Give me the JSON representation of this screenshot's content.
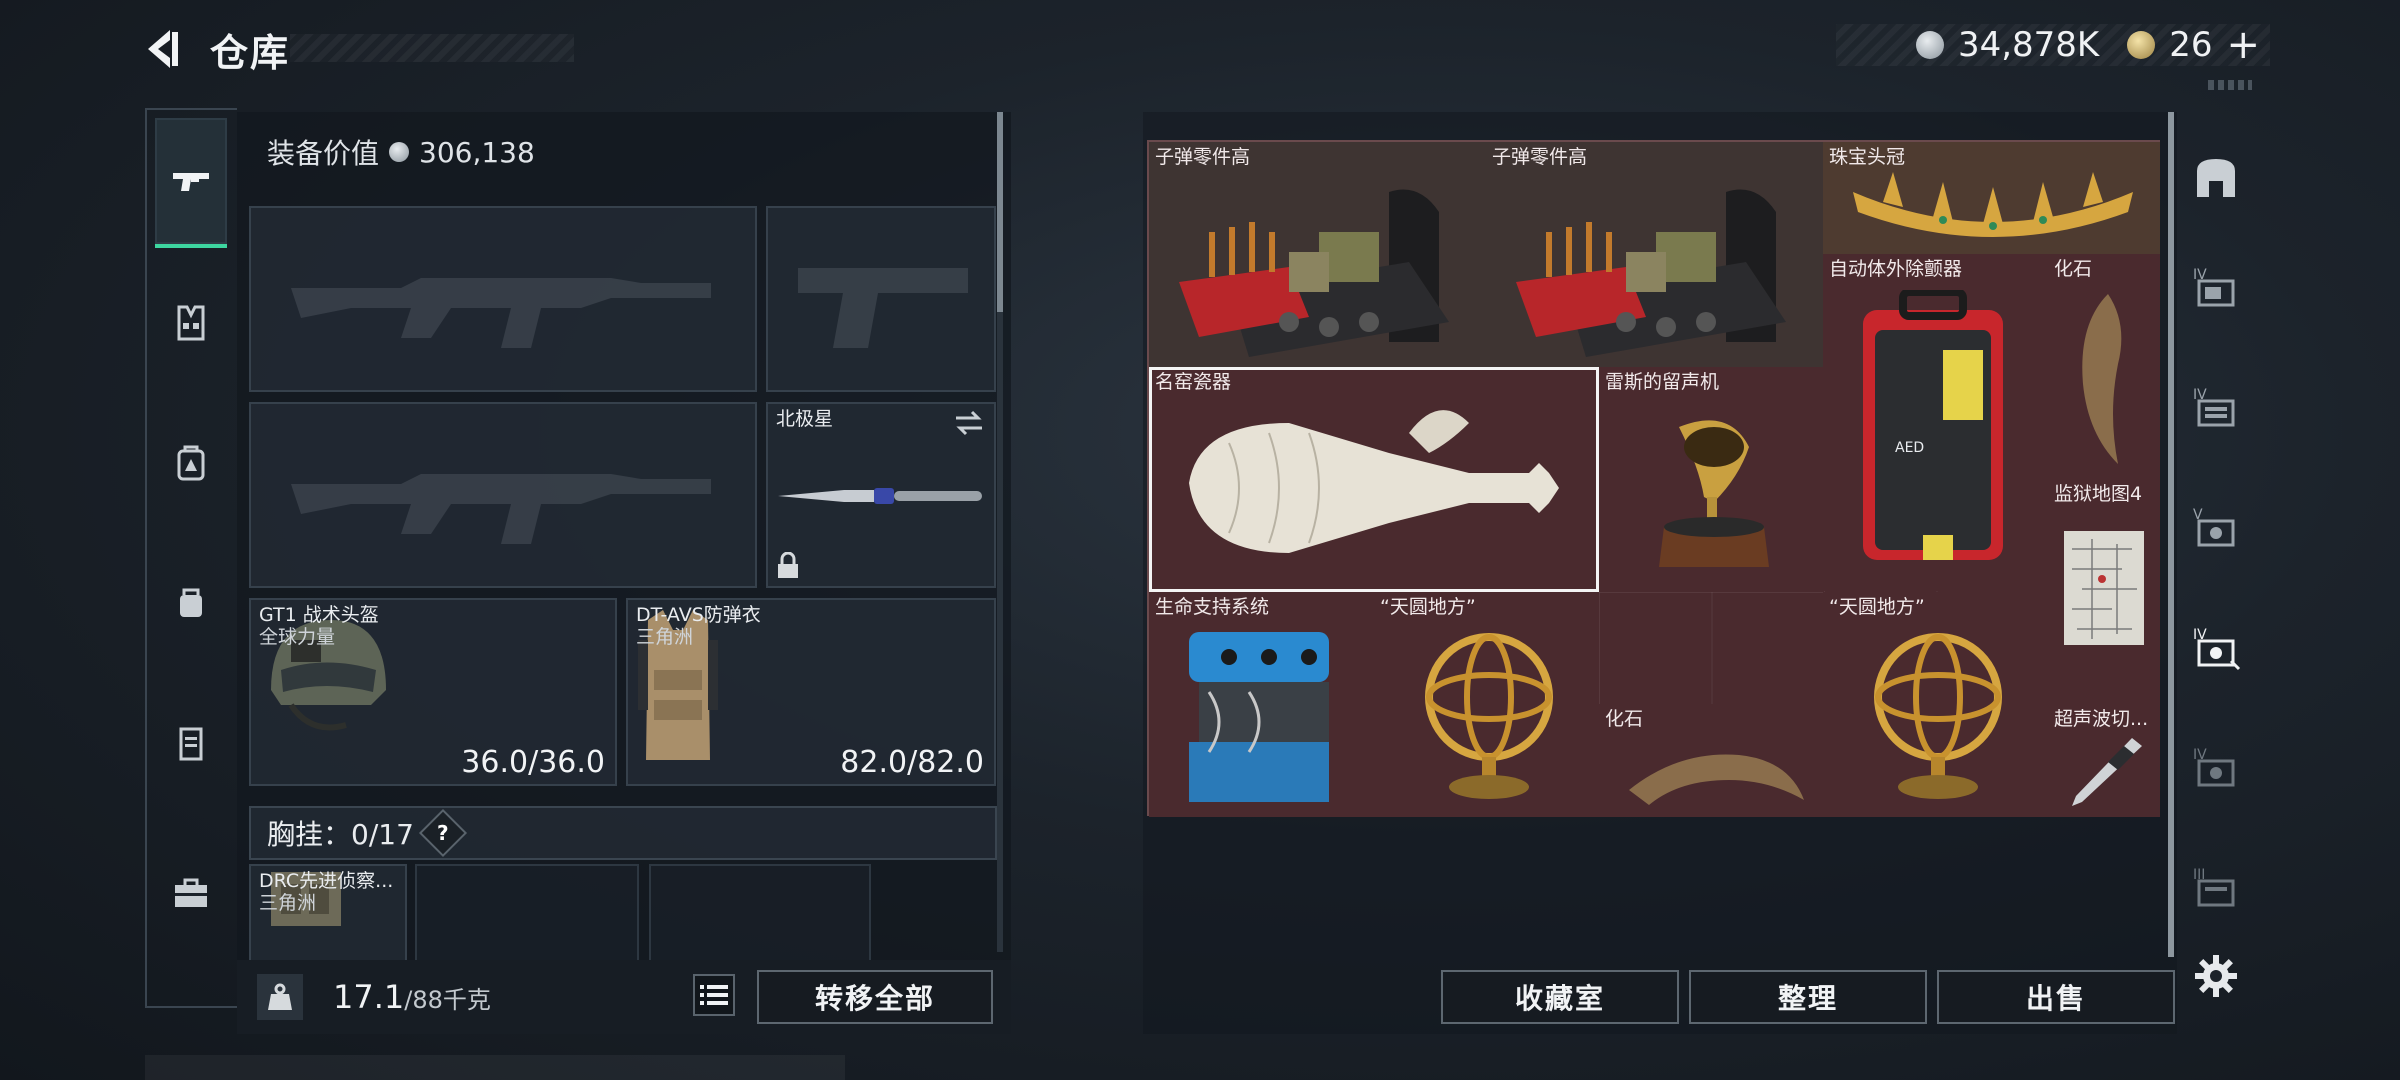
{
  "header": {
    "title": "仓库",
    "currency_silver": "34,878K",
    "currency_gold": "26",
    "plus_label": "+"
  },
  "left": {
    "equip_value_label": "装备价值",
    "equip_value": "306,138",
    "slots": {
      "knife_name": "北极星",
      "helmet_name": "GT1 战术头盔",
      "helmet_sub": "全球力量",
      "helmet_durability": "36.0/36.0",
      "armor_name": "DT-AVS防弹衣",
      "armor_sub": "三角洲",
      "armor_durability": "82.0/82.0"
    },
    "chest_label": "胸挂：0/17",
    "help_label": "?",
    "chest_item_name": "DRC先进侦察...",
    "chest_item_sub": "三角洲",
    "weight_value": "17.1",
    "weight_max": "/88千克",
    "transfer_all": "转移全部"
  },
  "stash": {
    "items": [
      {
        "name": "子弹零件高"
      },
      {
        "name": "子弹零件高"
      },
      {
        "name": "珠宝头冠"
      },
      {
        "name": "自动体外除颤器"
      },
      {
        "name": "化石"
      },
      {
        "name": "名窑瓷器"
      },
      {
        "name": "雷斯的留声机"
      },
      {
        "name": "监狱地图4"
      },
      {
        "name": "生命支持系统"
      },
      {
        "name": "“天圆地方”"
      },
      {
        "name": "“天圆地方”"
      },
      {
        "name": "化石"
      },
      {
        "name": "超声波切..."
      }
    ],
    "aed_label": "AED",
    "buttons": {
      "collection": "收藏室",
      "organize": "整理",
      "sell": "出售"
    }
  },
  "colors": {
    "accent": "#3dd6a0",
    "stash_bg": "#4a2a2e",
    "panel_bg": "#12181f"
  },
  "icons": {
    "left_tabs": [
      "gun-icon",
      "vest-icon",
      "backpack-icon",
      "pouch-icon",
      "case-icon",
      "toolbox-icon"
    ],
    "right_tabs": [
      "safe-icon",
      "container-4-icon",
      "container-4b-icon",
      "container-5-icon",
      "container-4c-icon",
      "container-4d-icon",
      "container-3-icon",
      "gear-icon"
    ]
  }
}
